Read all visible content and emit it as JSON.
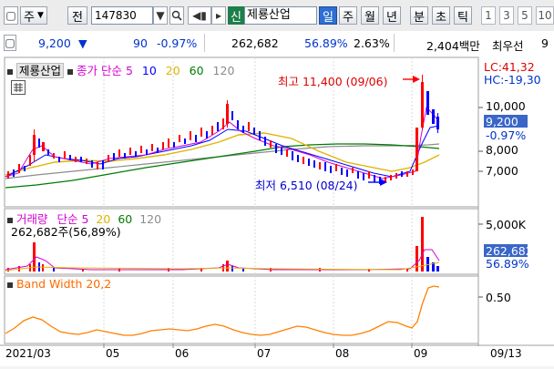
{
  "toolbar": {
    "market_dropdown": "주",
    "type_label": "전",
    "code": "147830",
    "new_tag": "신",
    "stock_name": "제룡산업",
    "timeframes": [
      "일",
      "주",
      "월",
      "년",
      "분",
      "초",
      "틱"
    ],
    "active_timeframe": "일",
    "periods": [
      "1",
      "3",
      "5",
      "10"
    ]
  },
  "quote": {
    "price": "9,200",
    "arrow": "▼",
    "change": "90",
    "change_pct": "-0.97%",
    "volume": "262,682",
    "volume_ratio": "56.89%",
    "turnover": "2.63%",
    "amount": "2,404백만",
    "extra": "최우선",
    "tail": "9"
  },
  "price_panel": {
    "legend_stock": "제룡산업",
    "legend_ma_label": "종가 단순",
    "ma_periods": [
      "5",
      "10",
      "20",
      "60",
      "120"
    ],
    "ma_colors": [
      "#d400d4",
      "#0000ff",
      "#e0b400",
      "#007b00",
      "#8c8c8c"
    ],
    "lc": "LC:41,32",
    "hc": "HC:-19,30",
    "high_annotation": "최고 11,400 (09/06)",
    "low_annotation": "최저 6,510 (08/24)",
    "current_price": "9,200",
    "current_pct": "-0.97%",
    "y_ticks": [
      "10,000",
      "8,000",
      "7,000"
    ]
  },
  "volume_panel": {
    "label_volume": "거래량",
    "label_ma": "단순",
    "ma_periods": [
      "5",
      "20",
      "60",
      "120"
    ],
    "value_line": "262,682주(56,89%)",
    "current": "262,682",
    "current_pct": "56.89%",
    "y_tick": "5,000K"
  },
  "bw_panel": {
    "label": "Band Width 20,2",
    "y_tick": "0.50"
  },
  "x_axis": [
    "2021/03",
    "05",
    "06",
    "07",
    "08",
    "09",
    "09/13"
  ],
  "chart_data": [
    {
      "type": "candlestick",
      "title": "제룡산업",
      "y_unit": "KRW",
      "x_range": [
        "2021/03",
        "2021/09/13"
      ],
      "ylim": [
        6000,
        11800
      ],
      "ohlc_daily_approx_close": [
        6600,
        6700,
        6600,
        6800,
        6750,
        6700,
        7200,
        8500,
        7600,
        7300,
        7200,
        7100,
        7300,
        7400,
        7250,
        7200,
        7300,
        7350,
        7400,
        7300,
        7350,
        7500,
        7400,
        7300,
        7200,
        7250,
        7300,
        7350,
        7300,
        7200,
        7150,
        7050,
        7100,
        7200,
        7300,
        7400,
        7600,
        7500,
        7550,
        7600,
        7700,
        7800,
        7650,
        7600,
        7700,
        7800,
        7900,
        7850,
        7800,
        7750,
        7900,
        8000,
        8100,
        8050,
        8000,
        7950,
        8200,
        8400,
        8300,
        8200,
        8100,
        8050,
        8100,
        8200,
        8400,
        8350,
        8200,
        8300,
        8500,
        8600,
        8500,
        8700,
        8900,
        8800,
        9000,
        8700,
        8500,
        8400,
        8300,
        8600,
        8500,
        8700,
        9800,
        9600,
        9000,
        8700,
        8500,
        8700,
        8800,
        8400,
        8200,
        8300,
        8500,
        8300,
        8000,
        7900,
        7800,
        7600,
        7500,
        7800,
        7700,
        7500,
        7300,
        7400,
        7200,
        7300,
        7100,
        6900,
        7000,
        6800,
        6900,
        7000,
        6800,
        6700,
        6650,
        6700,
        6600,
        6800,
        6850,
        6900,
        6950,
        7000,
        7050,
        7100,
        8600,
        11400,
        10400,
        9800,
        9300,
        9200
      ],
      "series": [
        {
          "name": "5",
          "values": "moving average of close"
        },
        {
          "name": "10",
          "values": "moving average of close"
        },
        {
          "name": "20",
          "values": "moving average of close"
        },
        {
          "name": "60",
          "values": "moving average of close"
        },
        {
          "name": "120",
          "values": "moving average of close"
        }
      ],
      "annotations": [
        {
          "text": "최고 11,400 (09/06)",
          "x": "2021/09/06",
          "y": 11400
        },
        {
          "text": "최저 6,510 (08/24)",
          "x": "2021/08/24",
          "y": 6510
        }
      ]
    },
    {
      "type": "bar",
      "title": "거래량",
      "ylim": [
        0,
        6000
      ],
      "y_unit": "K",
      "spikes": [
        {
          "x": "2021/03 late",
          "value": 3000
        },
        {
          "x": "2021/09/06",
          "value": 5600
        },
        {
          "x": "2021/09/07",
          "value": 2900
        },
        {
          "x": "2021/09/13",
          "value": 262.682
        }
      ]
    },
    {
      "type": "line",
      "title": "Band Width 20,2",
      "ylim": [
        0,
        0.7
      ],
      "values": [
        0.12,
        0.18,
        0.26,
        0.3,
        0.27,
        0.2,
        0.14,
        0.12,
        0.11,
        0.13,
        0.16,
        0.14,
        0.12,
        0.1,
        0.1,
        0.12,
        0.15,
        0.16,
        0.17,
        0.16,
        0.15,
        0.17,
        0.2,
        0.22,
        0.2,
        0.16,
        0.13,
        0.11,
        0.1,
        0.11,
        0.14,
        0.17,
        0.2,
        0.19,
        0.16,
        0.13,
        0.11,
        0.1,
        0.1,
        0.12,
        0.15,
        0.2,
        0.25,
        0.24,
        0.2,
        0.17,
        0.25,
        0.45,
        0.62,
        0.64
      ]
    }
  ]
}
